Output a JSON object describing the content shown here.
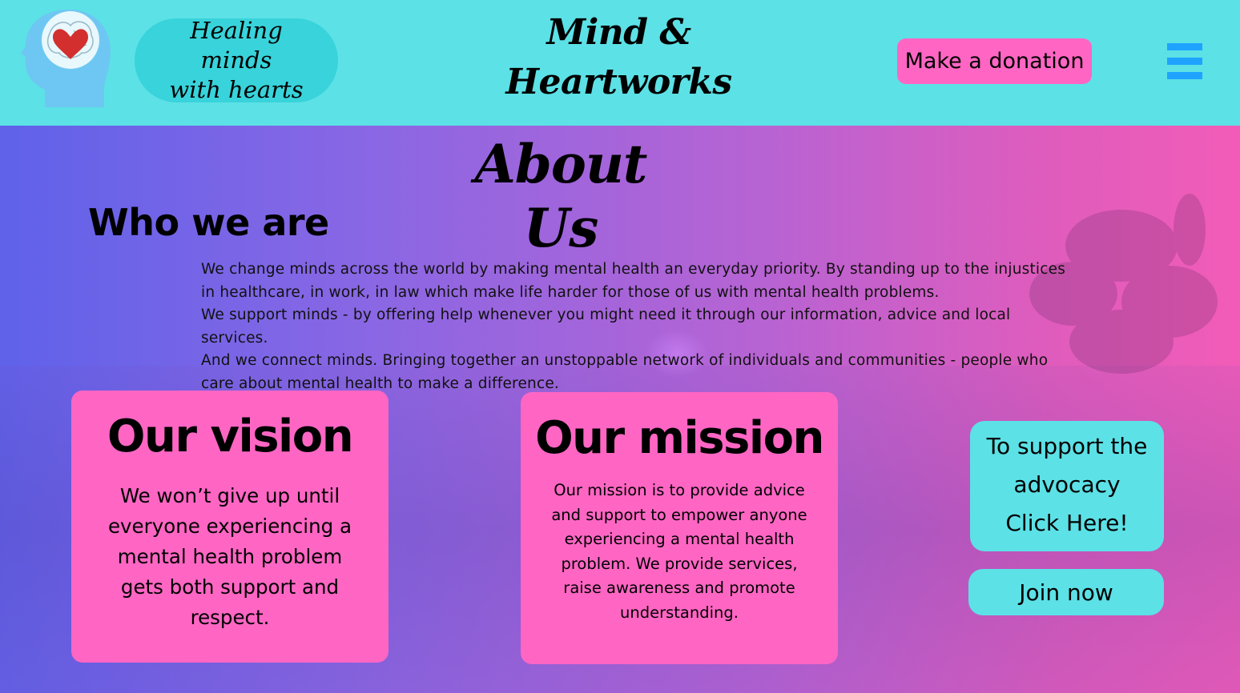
{
  "header": {
    "tagline_line1": "Healing minds",
    "tagline_line2": "with hearts",
    "title_line1": "Mind &",
    "title_line2": "Heartworks",
    "donate_label": "Make a donation",
    "logo_icon": "brain-heart-head-icon",
    "menu_icon": "hamburger-menu-icon"
  },
  "main": {
    "page_title": "About Us",
    "section_heading": "Who we are",
    "intro_paragraphs": [
      "We change minds across the world by making mental health an everyday priority. By standing up to the injustices in healthcare, in work, in law which make life harder for those of us with mental health problems.",
      "We support minds - by offering help whenever you might need it through our information, advice and local services.",
      "And we connect minds. Bringing together an unstoppable network of individuals and communities - people who care about mental health to make a difference."
    ],
    "vision": {
      "heading": "Our vision",
      "text": "We won’t give up until everyone experiencing a mental health problem gets both support and respect."
    },
    "mission": {
      "heading": "Our mission",
      "text": "Our mission is to provide advice and support to empower anyone experiencing a mental health problem. We provide services, raise awareness and promote understanding."
    },
    "support_button": {
      "line1": "To support the",
      "line2": "advocacy",
      "line3": "Click Here!"
    },
    "join_label": "Join now"
  },
  "colors": {
    "header_bg": "#5ce1e6",
    "pill_bg": "#38d3db",
    "card_pink": "#ff66c4",
    "menu_blue": "#1ea3ff",
    "gradient_left": "#5f62ea",
    "gradient_right": "#f25cb8"
  }
}
